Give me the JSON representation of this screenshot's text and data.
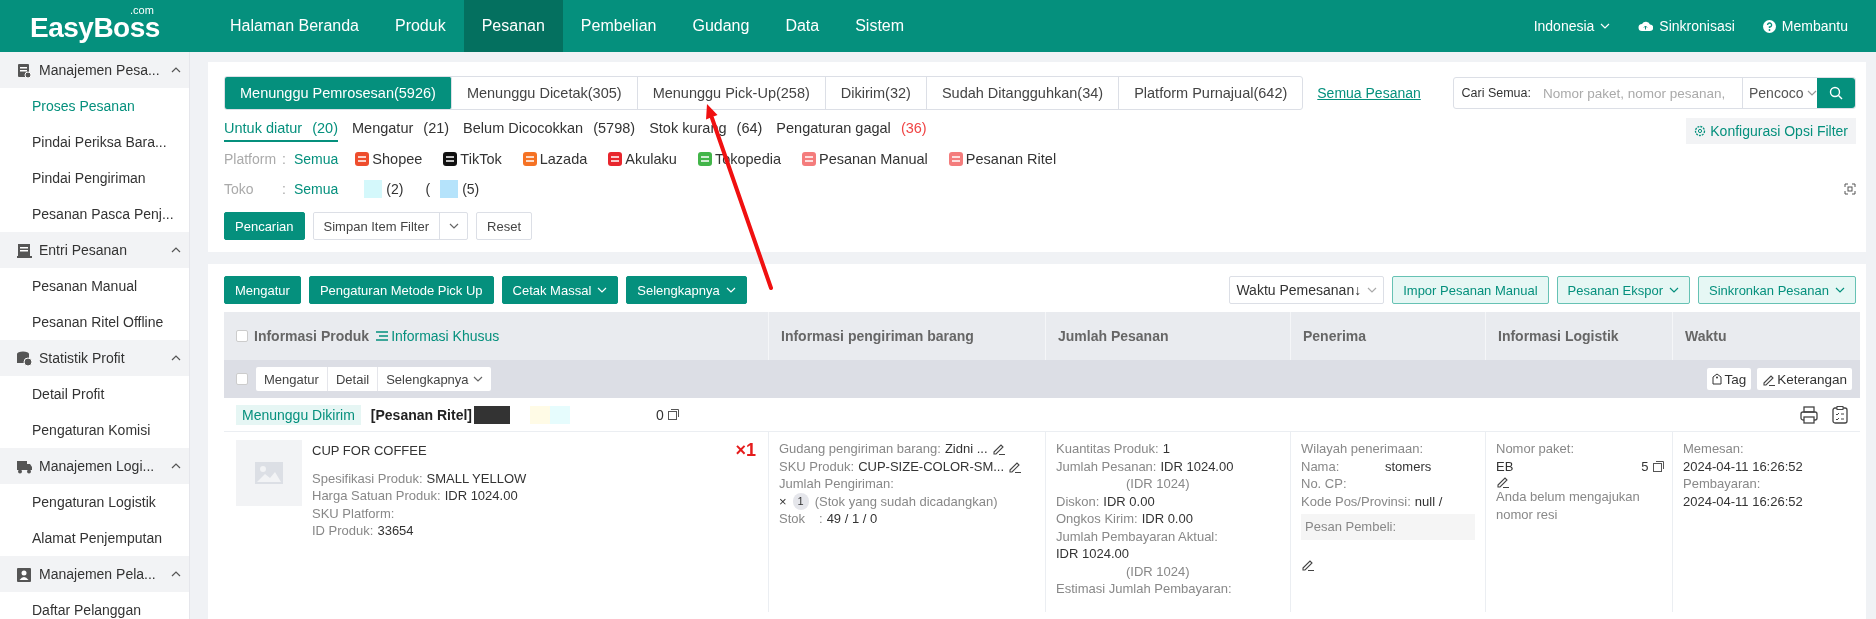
{
  "nav": {
    "logo": "EasyBoss",
    "logo_suffix": ".com",
    "menu": [
      {
        "label": "Halaman Beranda",
        "selected": false
      },
      {
        "label": "Produk",
        "selected": false
      },
      {
        "label": "Pesanan",
        "selected": true
      },
      {
        "label": "Pembelian",
        "selected": false
      },
      {
        "label": "Gudang",
        "selected": false
      },
      {
        "label": "Data",
        "selected": false
      },
      {
        "label": "Sistem",
        "selected": false
      }
    ],
    "region": "Indonesia",
    "sync": "Sinkronisasi",
    "help": "Membantu"
  },
  "sidebar": [
    {
      "label": "Manajemen Pesa...",
      "expanded": true,
      "items": [
        {
          "label": "Proses Pesanan",
          "selected": true
        },
        {
          "label": "Pindai Periksa Bara...",
          "selected": false
        },
        {
          "label": "Pindai Pengiriman",
          "selected": false
        },
        {
          "label": "Pesanan Pasca Penj...",
          "selected": false
        }
      ]
    },
    {
      "label": "Entri Pesanan",
      "expanded": true,
      "items": [
        {
          "label": "Pesanan Manual",
          "selected": false
        },
        {
          "label": "Pesanan Ritel Offline",
          "selected": false
        }
      ]
    },
    {
      "label": "Statistik Profit",
      "expanded": true,
      "items": [
        {
          "label": "Detail Profit",
          "selected": false
        },
        {
          "label": "Pengaturan Komisi",
          "selected": false
        }
      ]
    },
    {
      "label": "Manajemen Logi...",
      "expanded": true,
      "items": [
        {
          "label": "Pengaturan Logistik",
          "selected": false
        },
        {
          "label": "Alamat Penjemputan",
          "selected": false
        }
      ]
    },
    {
      "label": "Manajemen Pela...",
      "expanded": true,
      "items": [
        {
          "label": "Daftar Pelanggan",
          "selected": false
        }
      ]
    }
  ],
  "tabs": [
    {
      "label": "Menunggu Pemrosesan(5926)",
      "selected": true
    },
    {
      "label": "Menunggu Dicetak(305)",
      "selected": false
    },
    {
      "label": "Menunggu Pick-Up(258)",
      "selected": false
    },
    {
      "label": "Dikirim(32)",
      "selected": false
    },
    {
      "label": "Sudah Ditangguhkan(34)",
      "selected": false
    },
    {
      "label": "Platform Purnajual(642)",
      "selected": false
    }
  ],
  "all_orders_link": "Semua Pesanan",
  "search": {
    "label": "Cari Semua:",
    "placeholder": "Nomor paket, nomor pesanan,",
    "mode": "Pencoco"
  },
  "filter_config": "Konfigurasi Opsi Filter",
  "subtabs": [
    {
      "label": "Untuk diatur",
      "count": "(20)",
      "selected": true,
      "alert": false
    },
    {
      "label": "Mengatur",
      "count": "(21)",
      "selected": false,
      "alert": false
    },
    {
      "label": "Belum Dicocokkan",
      "count": "(5798)",
      "selected": false,
      "alert": false
    },
    {
      "label": "Stok kurang",
      "count": "(64)",
      "selected": false,
      "alert": false
    },
    {
      "label": "Pengaturan gagal",
      "count": "(36)",
      "selected": false,
      "alert": true
    }
  ],
  "platform_filter": {
    "label": "Platform",
    "separator": ":",
    "all": "Semua",
    "options": [
      {
        "label": "Shopee",
        "color": "#ee4d2d"
      },
      {
        "label": "TikTok",
        "color": "#111111"
      },
      {
        "label": "Lazada",
        "color": "#f57224"
      },
      {
        "label": "Akulaku",
        "color": "#e8262d"
      },
      {
        "label": "Tokopedia",
        "color": "#42b549"
      },
      {
        "label": "Pesanan Manual",
        "color": "#f47c7c"
      },
      {
        "label": "Pesanan Ritel",
        "color": "#f47c7c"
      }
    ]
  },
  "shop_filter": {
    "label": "Toko",
    "separator": ":",
    "all": "Semua",
    "shops": [
      {
        "count": "(2)",
        "color": "#d4f8fb"
      },
      {
        "prefix": "(",
        "count": "(5)",
        "color": "#b5e3fb"
      }
    ]
  },
  "filter_buttons": {
    "search": "Pencarian",
    "save": "Simpan Item Filter",
    "reset": "Reset"
  },
  "toolbar": {
    "actions": [
      {
        "label": "Mengatur",
        "dropdown": false
      },
      {
        "label": "Pengaturan Metode Pick Up",
        "dropdown": false
      },
      {
        "label": "Cetak Massal",
        "dropdown": true
      },
      {
        "label": "Selengkapnya",
        "dropdown": true
      }
    ],
    "sort": "Waktu Pemesanan↓",
    "right": [
      {
        "label": "Impor Pesanan Manual",
        "dropdown": false
      },
      {
        "label": "Pesanan Ekspor",
        "dropdown": true
      },
      {
        "label": "Sinkronkan Pesanan",
        "dropdown": true
      }
    ]
  },
  "table": {
    "columns": [
      "Informasi Produk",
      "Informasi pengiriman barang",
      "Jumlah Pesanan",
      "Penerima",
      "Informasi Logistik",
      "Waktu"
    ],
    "select_all_checked": false,
    "special_info": "Informasi Khusus",
    "bulk_checked": false,
    "bulk": [
      "Mengatur",
      "Detail",
      "Selengkapnya"
    ],
    "tag": "Tag",
    "note": "Keterangan"
  },
  "order": {
    "status": "Menunggu Dikirim",
    "source": "[Pesanan Ritel]",
    "number_tail": "0",
    "product": {
      "name": "CUP FOR COFFEE",
      "fields": [
        {
          "label": "Spesifikasi Produk:",
          "value": "SMALL YELLOW"
        },
        {
          "label": "Harga Satuan Produk:",
          "value": "IDR 1024.00"
        },
        {
          "label": "SKU Platform:"
        },
        {
          "label": "ID Produk:",
          "value": "33654"
        }
      ],
      "quantity": "×1"
    },
    "shipping": {
      "warehouse_label": "Gudang pengiriman barang:",
      "warehouse": "Zidni ...",
      "sku_label": "SKU Produk:",
      "sku": "CUP-SIZE-COLOR-SM...",
      "amount_label": "Jumlah Pengiriman:",
      "times": "×",
      "amount": "1",
      "reserved": "(Stok yang sudah dicadangkan)",
      "stock_label": "Stok",
      "stock_separator": ":",
      "stock": "49 / 1 / 0"
    },
    "amounts": [
      {
        "kind": "pair",
        "label": "Kuantitas Produk:",
        "value": "1"
      },
      {
        "kind": "pair",
        "label": "Jumlah Pesanan:",
        "value": "IDR 1024.00"
      },
      {
        "kind": "note",
        "value": "(IDR 1024)"
      },
      {
        "kind": "pair",
        "label": "Diskon:",
        "value": "IDR 0.00"
      },
      {
        "kind": "pair",
        "label": "Ongkos Kirim:",
        "value": "IDR 0.00"
      },
      {
        "kind": "block",
        "label": "Jumlah Pembayaran Aktual:",
        "value": "IDR 1024.00"
      },
      {
        "kind": "note",
        "value": "(IDR 1024)"
      },
      {
        "kind": "block",
        "label": "Estimasi Jumlah Pembayaran:"
      }
    ],
    "recipient": {
      "region_label": "Wilayah penerimaan:",
      "fields": [
        {
          "label": "Nama:",
          "value": "stomers"
        },
        {
          "label": "No. CP:"
        },
        {
          "label": "Kode Pos/Provinsi:",
          "value": "null /"
        }
      ],
      "message_label": "Pesan Pembeli:"
    },
    "logistics": {
      "label": "Nomor paket:",
      "prefix": "EB",
      "suffix": "5",
      "hint": "Anda belum mengajukan nomor resi"
    },
    "time": [
      {
        "label": "Memesan:",
        "value": "2024-04-11 16:26:52"
      },
      {
        "label": "Pembayaran:",
        "value": "2024-04-11 16:26:52"
      }
    ]
  }
}
